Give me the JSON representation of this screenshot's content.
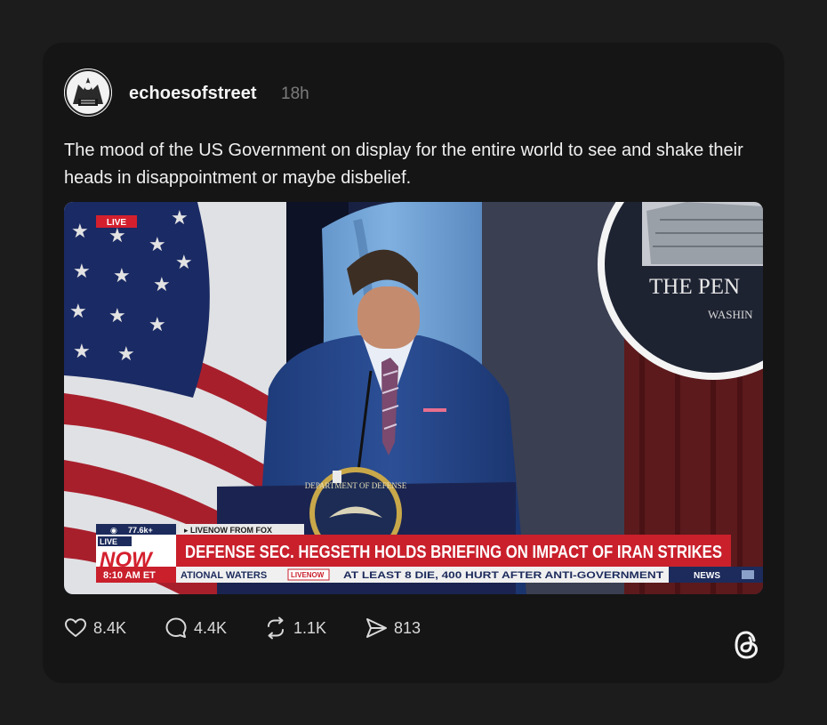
{
  "post": {
    "username": "echoesofstreet",
    "time_ago": "18h",
    "text": "The mood of the US Government on display for the entire world to see and shake their heads in disappointment or maybe disbelief."
  },
  "media": {
    "live_tag": "LIVE",
    "viewer_count": "77.6k+",
    "source_label": "▸ LIVENOW FROM FOX",
    "live_badge_top": "LIVE",
    "live_badge_main": "NOW",
    "time_label": "8:10 AM ET",
    "headline": "DEFENSE SEC. HEGSETH HOLDS BRIEFING ON IMPACT OF IRAN STRIKES",
    "ticker_left": "ATIONAL WATERS",
    "ticker_logo": "LIVENOW",
    "ticker_right": "AT LEAST 8 DIE, 400 HURT AFTER ANTI-GOVERNMENT",
    "news_label": "NEWS",
    "seal_title": "THE PEN",
    "seal_subtitle": "WASHIN",
    "podium_seal_text": "DEPARTMENT OF DEFENSE"
  },
  "actions": {
    "likes": "8.4K",
    "replies": "4.4K",
    "reposts": "1.1K",
    "shares": "813"
  },
  "icons": {
    "like": "heart-icon",
    "reply": "reply-bubble-icon",
    "repost": "repost-icon",
    "share": "share-send-icon",
    "brand": "threads-logo-icon"
  }
}
